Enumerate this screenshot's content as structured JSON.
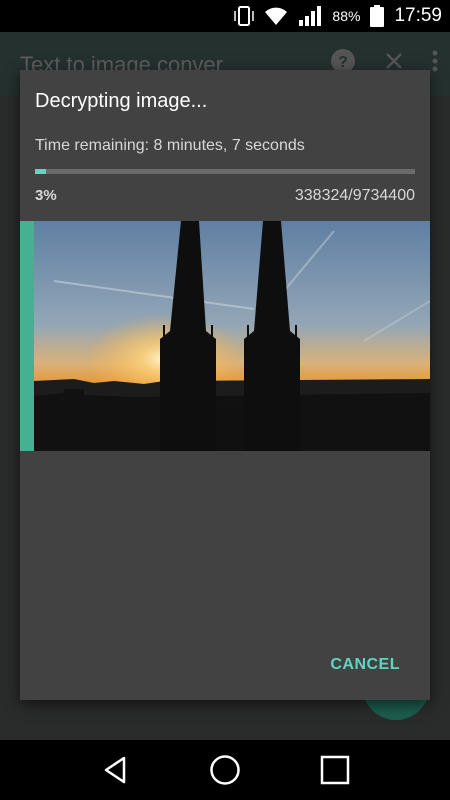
{
  "status_bar": {
    "battery_percent": "88%",
    "time": "17:59",
    "icons": [
      "vibrate-icon",
      "wifi-icon",
      "signal-icon",
      "battery-icon"
    ]
  },
  "app": {
    "title": "Text to image conver",
    "actions": [
      "help-icon",
      "close-icon",
      "more-vert-icon"
    ]
  },
  "dialog": {
    "title": "Decrypting image...",
    "message": "Time remaining: 8 minutes, 7 seconds",
    "progress": {
      "fraction": 0.03,
      "percent_label": "3%",
      "count_label": "338324/9734400"
    },
    "accent_color": "#5fd6c1",
    "image_description_icon": "photo-image",
    "cancel_label": "CANCEL"
  },
  "nav_bar": {
    "buttons": [
      "back-icon",
      "home-icon",
      "recents-icon"
    ]
  }
}
